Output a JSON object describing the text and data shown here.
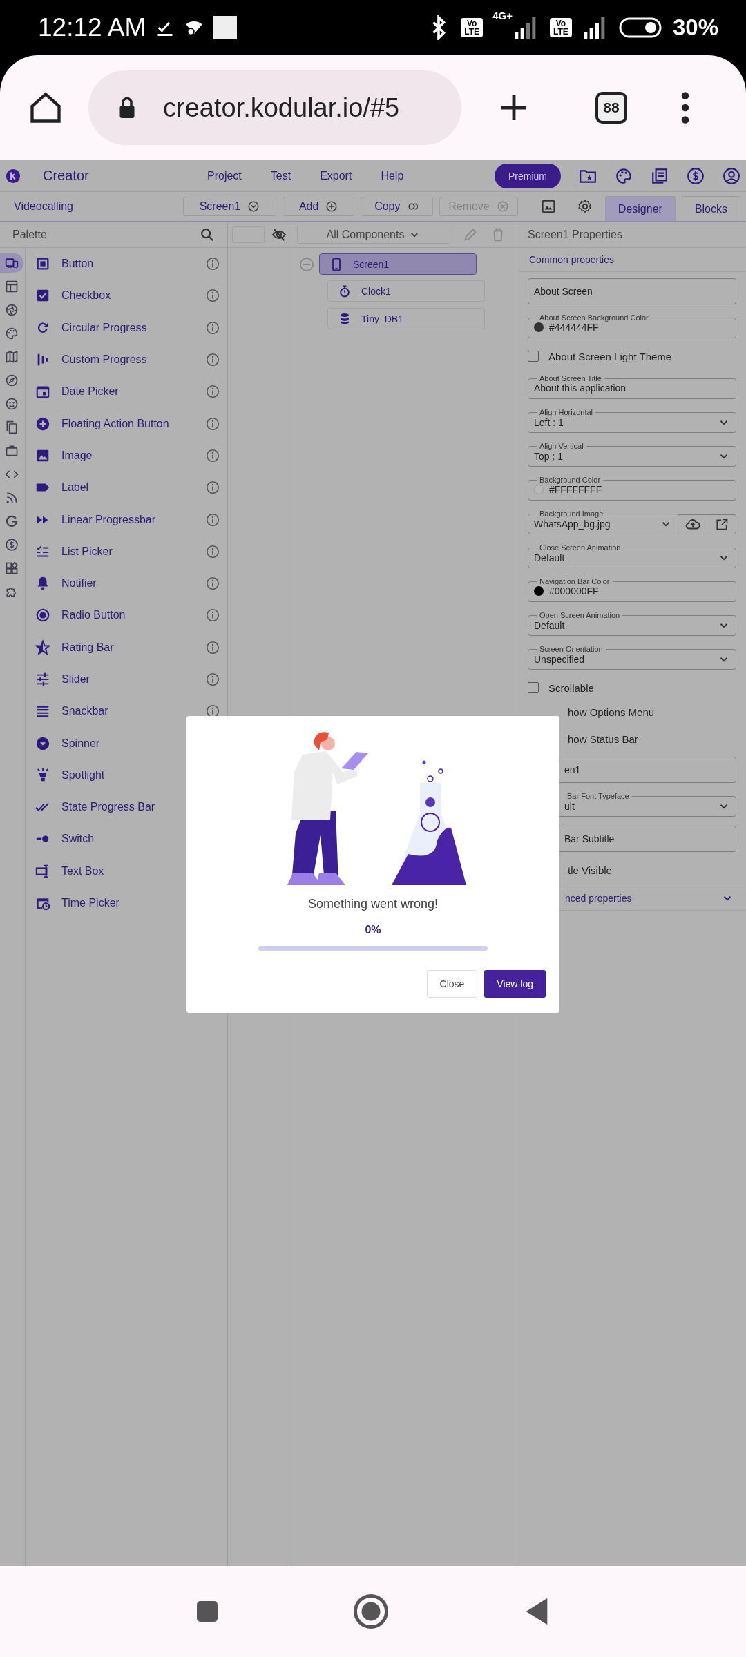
{
  "status_bar": {
    "time": "12:12 AM",
    "volte": [
      "Vo LTE",
      "Vo LTE"
    ],
    "network": "4G+",
    "battery": "30%"
  },
  "browser": {
    "url": "creator.kodular.io/#5",
    "tab_count": "88"
  },
  "app_header": {
    "title": "Creator",
    "menu": [
      "Project",
      "Test",
      "Export",
      "Help"
    ],
    "premium": "Premium"
  },
  "toolbar": {
    "project": "Videocalling",
    "screen": "Screen1",
    "buttons": [
      {
        "label": "Add",
        "disabled": false
      },
      {
        "label": "Copy",
        "disabled": false
      },
      {
        "label": "Remove",
        "disabled": true
      }
    ],
    "tabs": [
      {
        "label": "Designer",
        "selected": true
      },
      {
        "label": "Blocks",
        "selected": false
      }
    ]
  },
  "palette": {
    "title": "Palette",
    "categories": [
      {
        "selected": true
      },
      {
        "selected": false
      },
      {
        "selected": false
      },
      {
        "selected": false
      },
      {
        "selected": false
      },
      {
        "selected": false
      },
      {
        "selected": false
      },
      {
        "selected": false
      },
      {
        "selected": false
      },
      {
        "selected": false
      },
      {
        "selected": false
      },
      {
        "selected": false
      },
      {
        "selected": false
      },
      {
        "selected": false
      },
      {
        "selected": false
      }
    ],
    "items": [
      {
        "label": "Button",
        "info": true
      },
      {
        "label": "Checkbox",
        "info": true
      },
      {
        "label": "Circular Progress",
        "info": true
      },
      {
        "label": "Custom Progress",
        "info": true
      },
      {
        "label": "Date Picker",
        "info": true
      },
      {
        "label": "Floating Action Button",
        "info": true
      },
      {
        "label": "Image",
        "info": true
      },
      {
        "label": "Label",
        "info": true
      },
      {
        "label": "Linear Progressbar",
        "info": true
      },
      {
        "label": "List Picker",
        "info": true
      },
      {
        "label": "Notifier",
        "info": true
      },
      {
        "label": "Radio Button",
        "info": true
      },
      {
        "label": "Rating Bar",
        "info": true
      },
      {
        "label": "Slider",
        "info": true
      },
      {
        "label": "Snackbar",
        "info": true
      },
      {
        "label": "Spinner"
      },
      {
        "label": "Spotlight"
      },
      {
        "label": "State Progress Bar"
      },
      {
        "label": "Switch"
      },
      {
        "label": "Text Box"
      },
      {
        "label": "Time Picker"
      }
    ]
  },
  "components": {
    "filter": "All Components",
    "tree": [
      {
        "label": "Screen1",
        "selected": true,
        "expanded": true,
        "children": [
          {
            "label": "Clock1",
            "selected": false
          },
          {
            "label": "Tiny_DB1",
            "selected": false
          }
        ]
      }
    ]
  },
  "properties": {
    "title": "Screen1 Properties",
    "section": "Common properties",
    "items": [
      {
        "kind": "text",
        "value": "About Screen"
      },
      {
        "kind": "color",
        "label": "About Screen Background Color",
        "value": "#444444FF",
        "color": "#333333"
      },
      {
        "kind": "check",
        "label": "About Screen Light Theme",
        "checked": false
      },
      {
        "kind": "labeled",
        "label": "About Screen Title",
        "value": "About this application"
      },
      {
        "kind": "select",
        "label": "Align Horizontal",
        "value": "Left : 1"
      },
      {
        "kind": "select",
        "label": "Align Vertical",
        "value": "Top : 1"
      },
      {
        "kind": "color",
        "label": "Background Color",
        "value": "#FFFFFFFF",
        "color": "#b8b8b8"
      },
      {
        "kind": "file",
        "label": "Background Image",
        "value": "WhatsApp_bg.jpg"
      },
      {
        "kind": "select",
        "label": "Close Screen Animation",
        "value": "Default"
      },
      {
        "kind": "color",
        "label": "Navigation Bar Color",
        "value": "#000000FF",
        "color": "#000000"
      },
      {
        "kind": "select",
        "label": "Open Screen Animation",
        "value": "Default"
      },
      {
        "kind": "select",
        "label": "Screen Orientation",
        "value": "Unspecified"
      },
      {
        "kind": "check",
        "label": "Scrollable",
        "checked": false
      }
    ],
    "covered_items": [
      {
        "kind": "label",
        "label": "how Options Menu"
      },
      {
        "kind": "label",
        "label": "how Status Bar"
      },
      {
        "kind": "text",
        "value": "en1"
      },
      {
        "kind": "select",
        "label": "Bar Font Typeface",
        "value": "ult"
      },
      {
        "kind": "text",
        "value": "Bar Subtitle"
      },
      {
        "kind": "label",
        "label": "tle Visible"
      }
    ],
    "advanced": "nced properties"
  },
  "dialog": {
    "message": "Something went wrong!",
    "percent": "0%",
    "level": 0,
    "buttons": [
      {
        "label": "Close",
        "kind": "secondary"
      },
      {
        "label": "View log",
        "kind": "primary"
      }
    ]
  }
}
